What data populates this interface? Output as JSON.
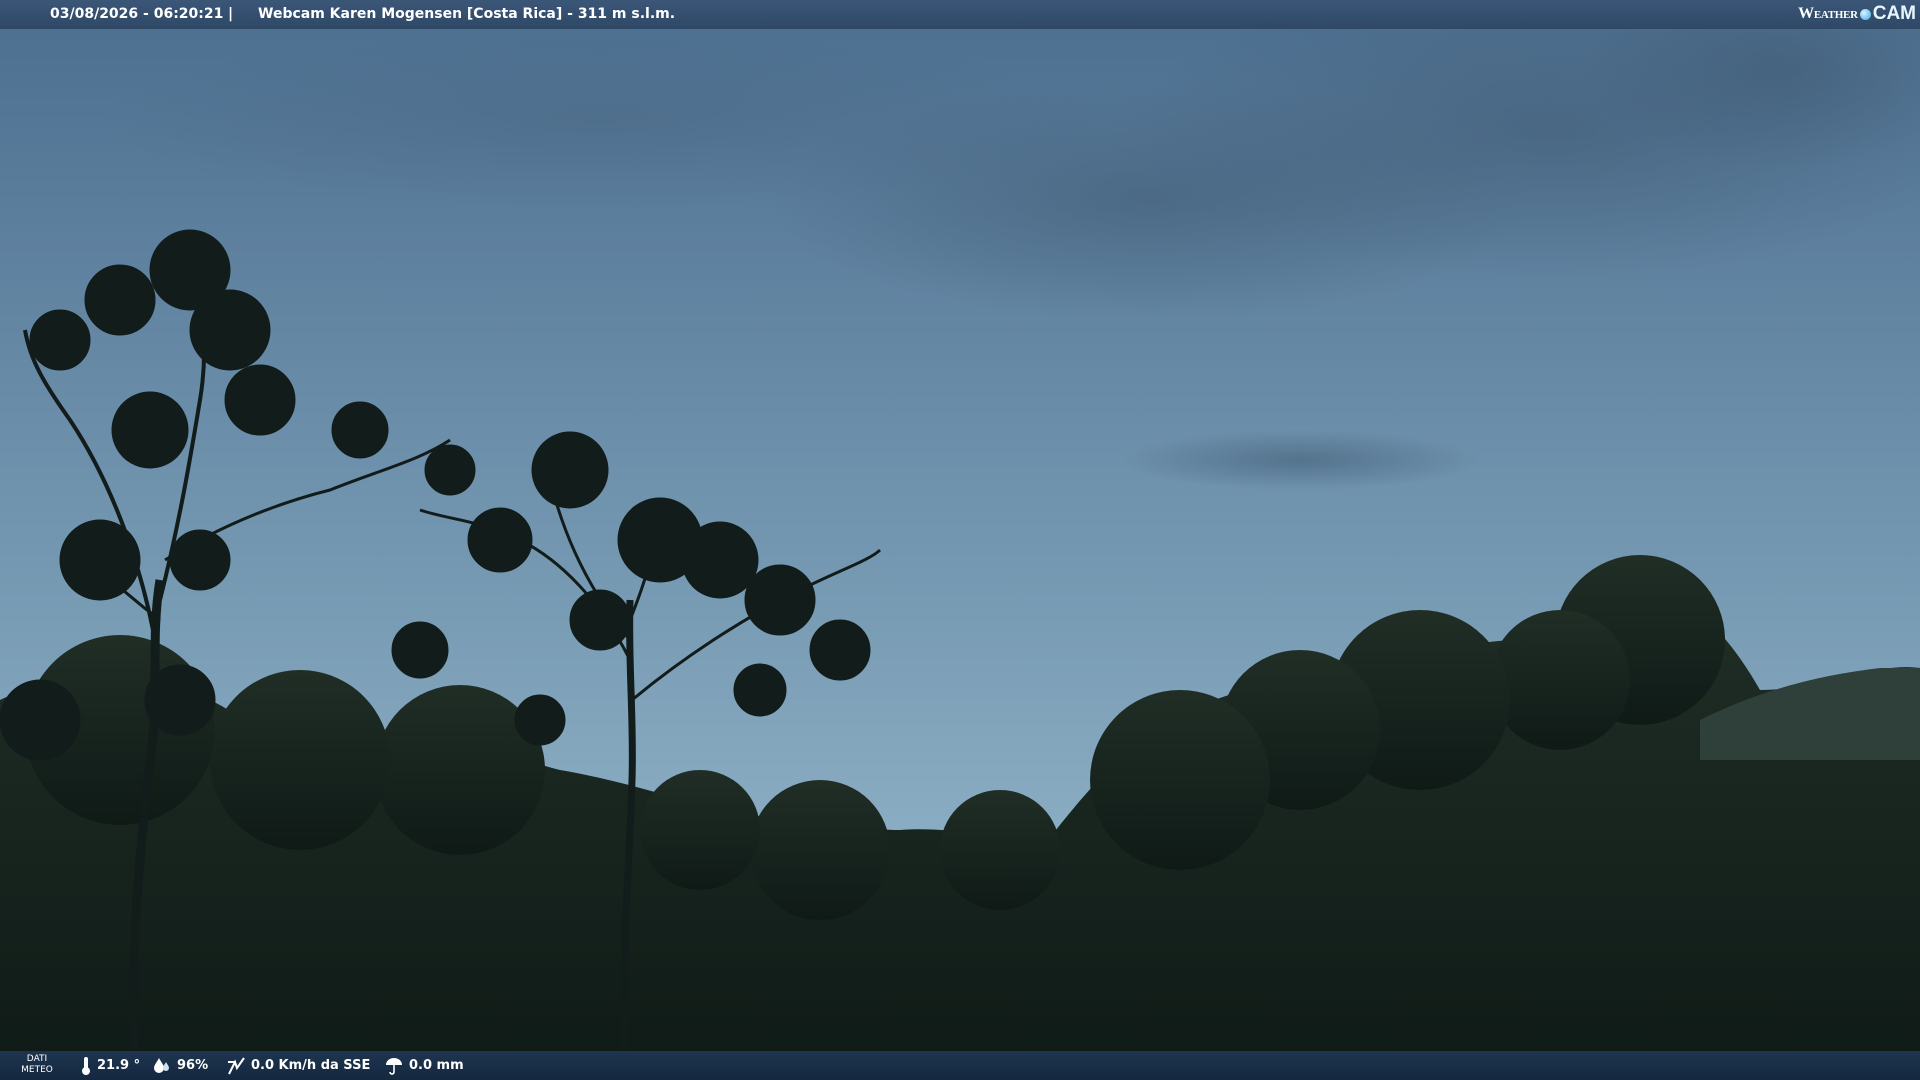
{
  "header": {
    "datetime": "03/08/2026 - 06:20:21",
    "separator": "|",
    "title": "Webcam Karen Mogensen [Costa Rica]  - 311 m s.l.m.",
    "brand_weather": "Weather",
    "brand_cam": "CAM"
  },
  "footer": {
    "dati_line1": "DATI",
    "dati_line2": "METEO",
    "temperature": "21.9 °",
    "humidity": "96%",
    "wind": "0.0 Km/h da SSE",
    "rain": "0.0 mm"
  },
  "icons": {
    "temperature": "thermometer-icon",
    "humidity": "humidity-icon",
    "wind": "wind-icon",
    "rain": "rain-icon"
  },
  "colors": {
    "sky_top": "#4a6d8e",
    "sky_bottom": "#8fb1c6",
    "vegetation": "#14201a",
    "bar": "#2e4866"
  }
}
